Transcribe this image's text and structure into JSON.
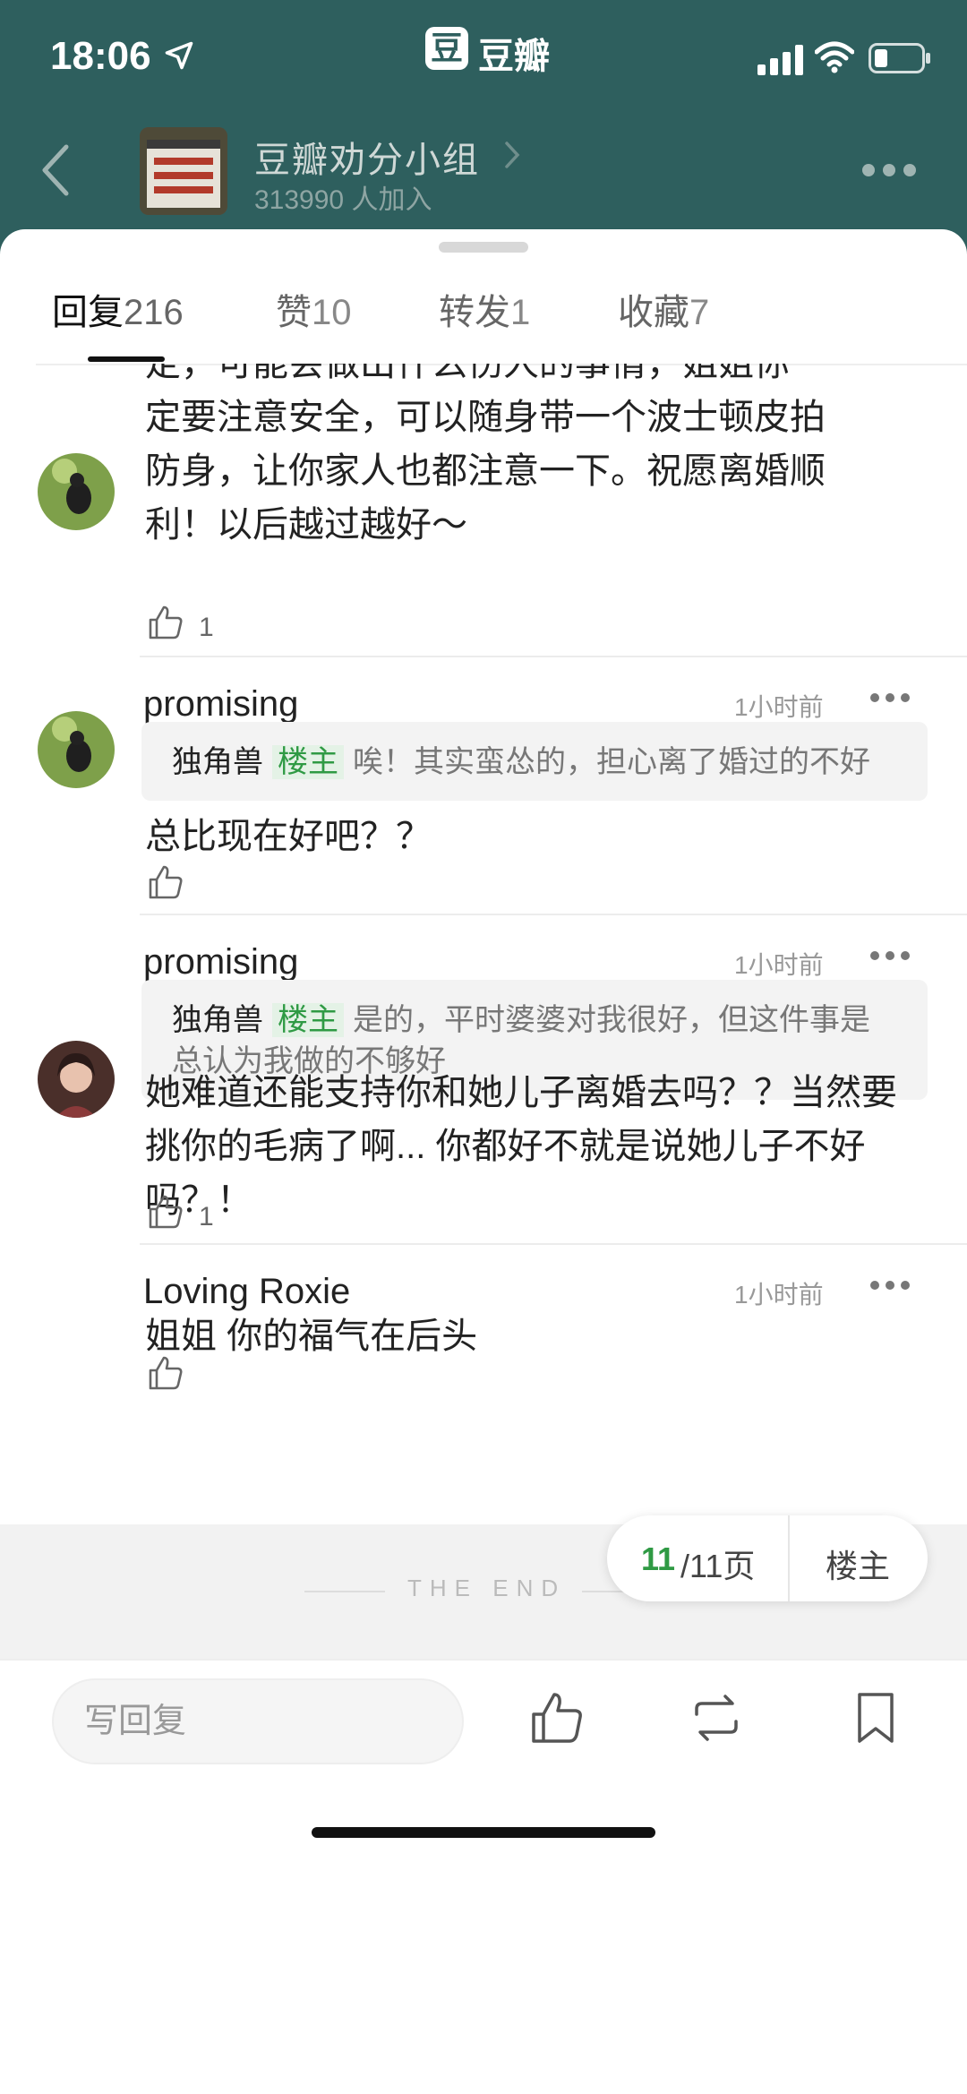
{
  "status": {
    "time": "18:06"
  },
  "app": {
    "badge": "豆",
    "name": "豆瓣"
  },
  "group": {
    "name": "豆瓣劝分小组",
    "members": "313990 人加入"
  },
  "tabs": [
    {
      "label": "回复",
      "count": "216"
    },
    {
      "label": "赞",
      "count": "10"
    },
    {
      "label": "转发",
      "count": "1"
    },
    {
      "label": "收藏",
      "count": "7"
    }
  ],
  "partial_comment": {
    "lines": [
      "定，可能会做出什么伤人的事情，姐姐你一",
      "定要注意安全，可以随身带一个波士顿皮拍",
      "防身，让你家人也都注意一下。祝愿离婚顺",
      "利！以后越过越好～"
    ],
    "likes": "1"
  },
  "comments": [
    {
      "user": "promising",
      "time": "1小时前",
      "quote_user": "独角兽",
      "quote_badge": "楼主",
      "quote_text": "唉！其实蛮怂的，担心离了婚过的不好",
      "text": "总比现在好吧？？",
      "likes": ""
    },
    {
      "user": "promising",
      "time": "1小时前",
      "quote_user": "独角兽",
      "quote_badge": "楼主",
      "quote_text": "是的，平时婆婆对我很好，但这件事是总认为我做的不够好",
      "text": "她难道还能支持你和她儿子离婚去吗？？当然要挑你的毛病了啊... 你都好不就是说她儿子不好吗？！",
      "likes": "1"
    },
    {
      "user": "Loving Roxie",
      "time": "1小时前",
      "text": "姐姐 你的福气在后头",
      "likes": ""
    }
  ],
  "end_text": "THE END",
  "pager": {
    "current": "11",
    "rest": "/11页",
    "op_button": "楼主"
  },
  "bottom": {
    "reply_placeholder": "写回复"
  },
  "colors": {
    "header_bg": "#2e5f5e",
    "accent_green": "#2f9a44"
  }
}
